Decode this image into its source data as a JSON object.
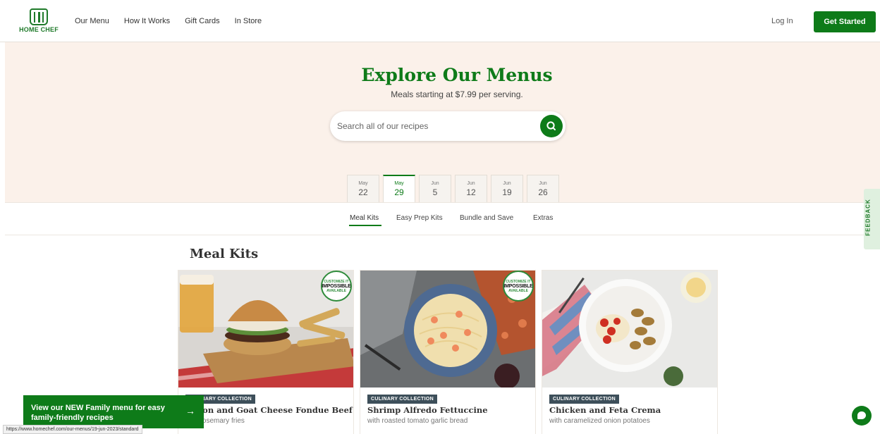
{
  "header": {
    "logo_text": "HOME CHEF",
    "nav": [
      "Our Menu",
      "How It Works",
      "Gift Cards",
      "In Store"
    ],
    "login_label": "Log In",
    "cta_label": "Get Started"
  },
  "hero": {
    "title": "Explore Our Menus",
    "subtitle": "Meals starting at $7.99 per serving.",
    "search_placeholder": "Search all of our recipes"
  },
  "dates": [
    {
      "month": "May",
      "day": "22",
      "active": false
    },
    {
      "month": "May",
      "day": "29",
      "active": true
    },
    {
      "month": "Jun",
      "day": "5",
      "active": false
    },
    {
      "month": "Jun",
      "day": "12",
      "active": false
    },
    {
      "month": "Jun",
      "day": "19",
      "active": false
    },
    {
      "month": "Jun",
      "day": "26",
      "active": false
    }
  ],
  "categories": [
    "Meal Kits",
    "Easy Prep Kits",
    "Bundle and Save",
    "Extras"
  ],
  "feedback_label": "FEEDBACK",
  "section_title": "Meal Kits",
  "cards": [
    {
      "badge": "CULINARY COLLECTION",
      "title": "Bacon and Goat Cheese Fondue Beef Burger",
      "subtitle": "with rosemary fries",
      "stamp": {
        "top": "CUSTOMIZE IT",
        "middle": "IMPOSSIBLE",
        "bottom": "AVAILABLE"
      }
    },
    {
      "badge": "CULINARY COLLECTION",
      "title": "Shrimp Alfredo Fettuccine",
      "subtitle": "with roasted tomato garlic bread",
      "stamp": {
        "top": "CUSTOMIZE IT",
        "middle": "IMPOSSIBLE",
        "bottom": "AVAILABLE"
      }
    },
    {
      "badge": "CULINARY COLLECTION",
      "title": "Chicken and Feta Crema",
      "subtitle": "with caramelized onion potatoes"
    }
  ],
  "promo": {
    "text": "View our NEW Family menu for easy family-friendly recipes",
    "arrow": "→"
  },
  "status_url": "https://www.homechef.com/our-menus/19-jun-2023/standard",
  "colors": {
    "brand_green": "#0e7b19",
    "hero_bg": "#fbf1ea",
    "badge_bg": "#3d4f5a"
  }
}
